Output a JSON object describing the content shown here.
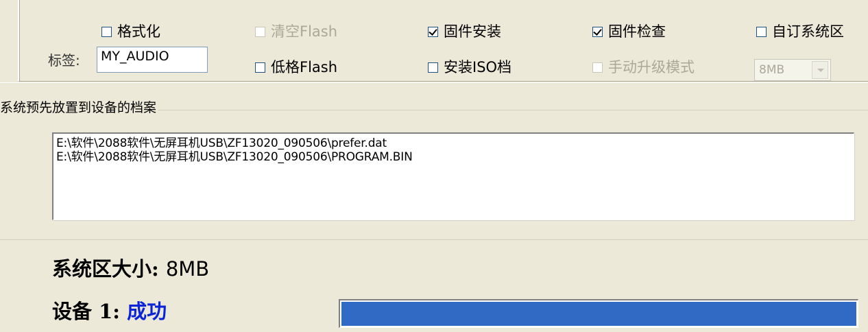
{
  "options": {
    "format": {
      "label": "格式化",
      "checked": false,
      "enabled": true
    },
    "clear_flash": {
      "label": "清空Flash",
      "checked": false,
      "enabled": false
    },
    "firmware_install": {
      "label": "固件安装",
      "checked": true,
      "enabled": true
    },
    "firmware_check": {
      "label": "固件检查",
      "checked": true,
      "enabled": true
    },
    "custom_system_area": {
      "label": "自订系统区",
      "checked": false,
      "enabled": true
    },
    "lowlevel_flash": {
      "label": "低格Flash",
      "checked": false,
      "enabled": true
    },
    "install_iso": {
      "label": "安装ISO档",
      "checked": false,
      "enabled": true
    },
    "manual_upgrade": {
      "label": "手动升级模式",
      "checked": false,
      "enabled": false
    },
    "volume_label": {
      "label": "标签:",
      "value": "MY_AUDIO"
    },
    "size_select": {
      "value": "8MB",
      "enabled": false
    }
  },
  "preload_group": {
    "title": "系统预先放置到设备的档案",
    "files": [
      "E:\\软件\\2088软件\\无屏耳机USB\\ZF13020_090506\\prefer.dat",
      "E:\\软件\\2088软件\\无屏耳机USB\\ZF13020_090506\\PROGRAM.BIN"
    ]
  },
  "system_area": {
    "label": "系统区大小:",
    "value": "8MB"
  },
  "device": {
    "label": "设备 1:",
    "status": "成功",
    "status_color": "#0a24d6",
    "progress": 1.0,
    "progress_color": "#316ac5"
  }
}
